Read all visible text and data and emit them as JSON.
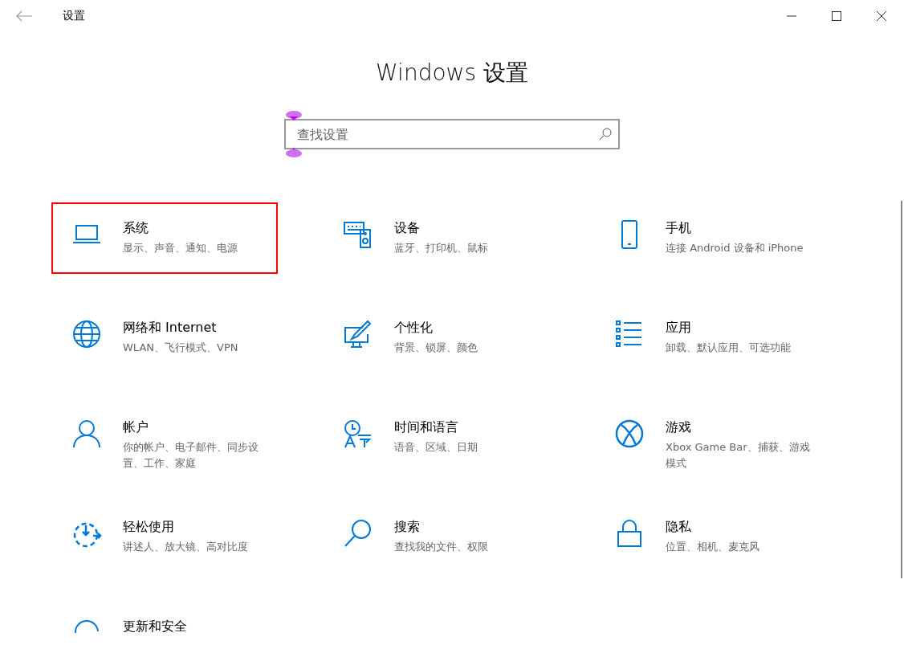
{
  "window": {
    "title": "设置"
  },
  "heading": "Windows 设置",
  "search": {
    "placeholder": "查找设置"
  },
  "categories": [
    {
      "title": "系统",
      "subtitle": "显示、声音、通知、电源",
      "highlighted": true
    },
    {
      "title": "设备",
      "subtitle": "蓝牙、打印机、鼠标",
      "highlighted": false
    },
    {
      "title": "手机",
      "subtitle": "连接 Android 设备和 iPhone",
      "highlighted": false
    },
    {
      "title": "网络和 Internet",
      "subtitle": "WLAN、飞行模式、VPN",
      "highlighted": false
    },
    {
      "title": "个性化",
      "subtitle": "背景、锁屏、颜色",
      "highlighted": false
    },
    {
      "title": "应用",
      "subtitle": "卸载、默认应用、可选功能",
      "highlighted": false
    },
    {
      "title": "帐户",
      "subtitle": "你的帐户、电子邮件、同步设置、工作、家庭",
      "highlighted": false
    },
    {
      "title": "时间和语言",
      "subtitle": "语音、区域、日期",
      "highlighted": false
    },
    {
      "title": "游戏",
      "subtitle": "Xbox Game Bar、捕获、游戏模式",
      "highlighted": false
    },
    {
      "title": "轻松使用",
      "subtitle": "讲述人、放大镜、高对比度",
      "highlighted": false
    },
    {
      "title": "搜索",
      "subtitle": "查找我的文件、权限",
      "highlighted": false
    },
    {
      "title": "隐私",
      "subtitle": "位置、相机、麦克风",
      "highlighted": false
    },
    {
      "title": "更新和安全",
      "highlighted": false
    }
  ]
}
